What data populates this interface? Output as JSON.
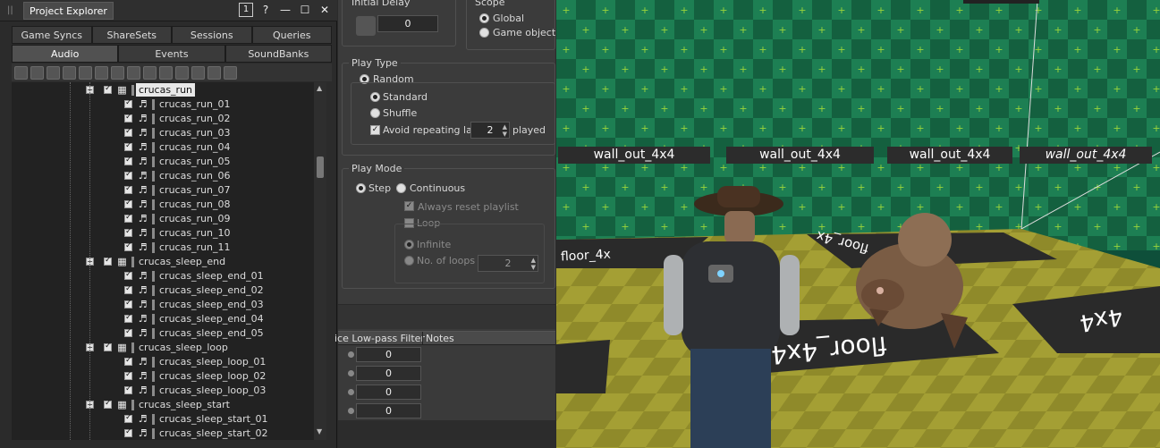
{
  "explorer": {
    "title": "Project Explorer",
    "window_buttons": [
      "1",
      "?",
      "—",
      "☐",
      "✕"
    ],
    "tabs_row1": [
      "Game Syncs",
      "ShareSets",
      "Sessions",
      "Queries"
    ],
    "tabs_row2": [
      "Audio",
      "Events",
      "SoundBanks"
    ],
    "active_tab": "Audio",
    "tree": [
      {
        "label": "crucas_run",
        "level": 0,
        "selected": true
      },
      {
        "label": "crucas_run_01",
        "level": 1
      },
      {
        "label": "crucas_run_02",
        "level": 1
      },
      {
        "label": "crucas_run_03",
        "level": 1
      },
      {
        "label": "crucas_run_04",
        "level": 1
      },
      {
        "label": "crucas_run_05",
        "level": 1
      },
      {
        "label": "crucas_run_06",
        "level": 1
      },
      {
        "label": "crucas_run_07",
        "level": 1
      },
      {
        "label": "crucas_run_08",
        "level": 1
      },
      {
        "label": "crucas_run_09",
        "level": 1
      },
      {
        "label": "crucas_run_10",
        "level": 1
      },
      {
        "label": "crucas_run_11",
        "level": 1
      },
      {
        "label": "crucas_sleep_end",
        "level": 0
      },
      {
        "label": "crucas_sleep_end_01",
        "level": 1
      },
      {
        "label": "crucas_sleep_end_02",
        "level": 1
      },
      {
        "label": "crucas_sleep_end_03",
        "level": 1
      },
      {
        "label": "crucas_sleep_end_04",
        "level": 1
      },
      {
        "label": "crucas_sleep_end_05",
        "level": 1
      },
      {
        "label": "crucas_sleep_loop",
        "level": 0
      },
      {
        "label": "crucas_sleep_loop_01",
        "level": 1
      },
      {
        "label": "crucas_sleep_loop_02",
        "level": 1
      },
      {
        "label": "crucas_sleep_loop_03",
        "level": 1
      },
      {
        "label": "crucas_sleep_start",
        "level": 0
      },
      {
        "label": "crucas_sleep_start_01",
        "level": 1
      },
      {
        "label": "crucas_sleep_start_02",
        "level": 1
      }
    ]
  },
  "props": {
    "initial_delay_label": "Initial Delay",
    "initial_delay_value": "0",
    "scope_label": "Scope",
    "scope_global": "Global",
    "scope_game_object": "Game object",
    "play_type_label": "Play Type",
    "random_label": "Random",
    "standard_label": "Standard",
    "shuffle_label": "Shuffle",
    "avoid_label": "Avoid repeating last",
    "avoid_value": "2",
    "played_label": "played",
    "play_mode_label": "Play Mode",
    "step_label": "Step",
    "continuous_label": "Continuous",
    "always_reset_label": "Always reset playlist",
    "loop_label": "Loop",
    "infinite_label": "Infinite",
    "no_of_loops_label": "No. of loops",
    "no_of_loops_value": "2",
    "lower_col1": "ice Low-pass Filter",
    "lower_col2": "Notes",
    "lower_values": [
      "0",
      "0",
      "0",
      "0"
    ]
  },
  "game": {
    "wall_labels": [
      "wall_out_4x4",
      "wall_out_4x4",
      "wall_out_4x4",
      "wall_out_4x4"
    ],
    "floor_labels": [
      "floor_4x",
      "floor_4x",
      "floor_4x4",
      "4x4"
    ]
  }
}
